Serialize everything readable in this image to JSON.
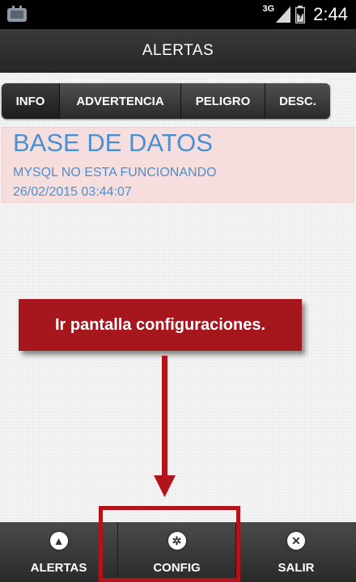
{
  "status_bar": {
    "network_type": "3G",
    "time": "2:44",
    "icons": [
      "app-icon",
      "signal-icon",
      "battery-icon"
    ]
  },
  "action_bar": {
    "title": "ALERTAS"
  },
  "tabs": [
    {
      "label": "INFO"
    },
    {
      "label": "ADVERTENCIA"
    },
    {
      "label": "PELIGRO"
    },
    {
      "label": "DESC."
    }
  ],
  "alert": {
    "title": "BASE DE DATOS",
    "message": "MYSQL NO ESTA FUNCIONANDO",
    "datetime": "26/02/2015 03:44:07"
  },
  "callout": {
    "text": "Ir pantalla configuraciones."
  },
  "bottom_nav": [
    {
      "label": "ALERTAS",
      "icon": "warning-icon",
      "glyph": "▲"
    },
    {
      "label": "CONFIG",
      "icon": "gear-icon",
      "glyph": "✲"
    },
    {
      "label": "SALIR",
      "icon": "close-icon",
      "glyph": "✕"
    }
  ],
  "colors": {
    "alert_bg": "#f7dede",
    "alert_text": "#4a90d0",
    "callout_bg": "#a5171d",
    "highlight": "#b3131b"
  }
}
